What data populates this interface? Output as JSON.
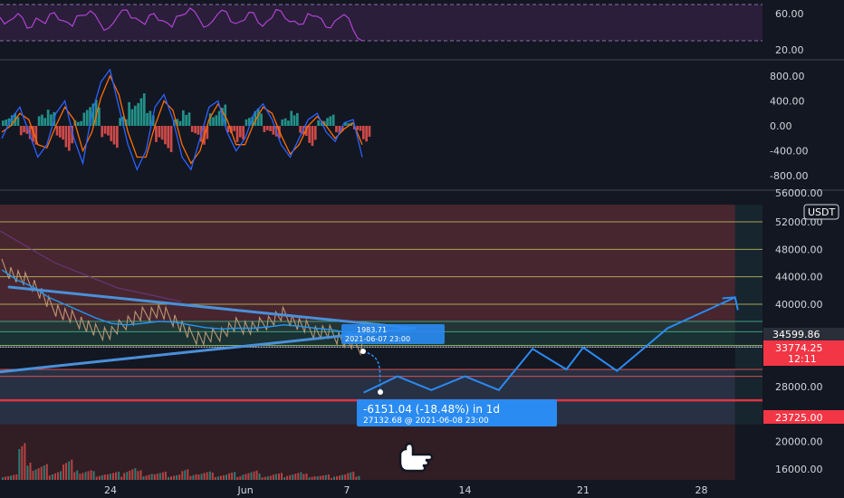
{
  "chart_data": [
    {
      "type": "line",
      "name": "RSI",
      "ylim": [
        10,
        75
      ],
      "yticks": [
        "60.00",
        "20.00"
      ],
      "ytick_values": [
        60,
        20
      ],
      "bands": [
        30,
        70
      ],
      "series": [
        {
          "values": [
            56,
            52,
            60,
            44,
            55,
            49,
            61,
            52,
            46,
            58,
            63,
            50,
            44,
            57,
            64,
            55,
            48,
            60,
            52,
            45,
            58,
            66,
            54,
            47,
            59,
            62,
            49,
            53,
            61,
            46,
            55,
            63,
            51,
            48,
            60,
            57,
            45,
            52,
            59,
            42,
            30
          ]
        }
      ]
    },
    {
      "type": "bar",
      "name": "MACD",
      "ylim": [
        -1000,
        1000
      ],
      "yticks": [
        "800.00",
        "400.00",
        "0.00",
        "-400.00",
        "-800.00"
      ],
      "ytick_values": [
        800,
        400,
        0,
        -400,
        -800
      ],
      "histogram": [
        120,
        200,
        -150,
        -300,
        180,
        260,
        -220,
        -400,
        90,
        300,
        420,
        -180,
        -350,
        150,
        380,
        520,
        240,
        -260,
        -420,
        110,
        250,
        -140,
        -300,
        200,
        340,
        -120,
        -260,
        150,
        280,
        -100,
        -200,
        120,
        240,
        -160,
        -320,
        90,
        180,
        -120,
        60,
        -80,
        -250
      ],
      "macd_line": [
        -200,
        100,
        300,
        -100,
        -500,
        -300,
        200,
        400,
        -200,
        -600,
        200,
        700,
        900,
        300,
        -300,
        -700,
        -400,
        300,
        500,
        100,
        -500,
        -700,
        -200,
        300,
        400,
        -100,
        -400,
        -200,
        200,
        350,
        100,
        -300,
        -500,
        -200,
        100,
        200,
        -100,
        -250,
        50,
        100,
        -500
      ],
      "signal_line": [
        -100,
        0,
        200,
        100,
        -300,
        -350,
        0,
        300,
        100,
        -400,
        -100,
        450,
        800,
        500,
        -100,
        -500,
        -500,
        0,
        400,
        250,
        -300,
        -600,
        -400,
        100,
        350,
        100,
        -300,
        -300,
        50,
        300,
        200,
        -150,
        -450,
        -300,
        0,
        150,
        0,
        -200,
        -50,
        50,
        -300
      ]
    },
    {
      "type": "line",
      "name": "BTC/USDT price",
      "unit": "USDT",
      "ylim": [
        14000,
        58000
      ],
      "yticks": [
        "52000.00",
        "48000.00",
        "44000.00",
        "40000.00",
        "28000.00",
        "20000.00",
        "16000.00"
      ],
      "ytick_values": [
        52000,
        48000,
        44000,
        40000,
        28000,
        20000,
        16000
      ],
      "x": [
        "2021-05-16",
        "2021-05-17",
        "2021-05-18",
        "2021-05-19",
        "2021-05-20",
        "2021-05-21",
        "2021-05-22",
        "2021-05-23",
        "2021-05-24",
        "2021-05-25",
        "2021-05-26",
        "2021-05-27",
        "2021-05-28",
        "2021-05-29",
        "2021-05-30",
        "2021-05-31",
        "2021-06-01",
        "2021-06-02",
        "2021-06-03",
        "2021-06-04",
        "2021-06-05",
        "2021-06-06",
        "2021-06-07",
        "2021-06-08"
      ],
      "xticks": [
        "24",
        "Jun",
        "7",
        "14",
        "21",
        "28"
      ],
      "xtick_dates": [
        "2021-05-24",
        "2021-06-01",
        "2021-06-07",
        "2021-06-14",
        "2021-06-21",
        "2021-06-28"
      ],
      "series": [
        {
          "values": [
            45500,
            44000,
            43000,
            40000,
            38500,
            37500,
            36000,
            35800,
            37500,
            38500,
            39000,
            37800,
            35500,
            35000,
            35800,
            37000,
            36500,
            37500,
            38500,
            37000,
            36000,
            35800,
            34500,
            33774
          ]
        },
        {
          "values": [
            45000,
            43500,
            42500,
            41000,
            40000,
            39000,
            38000,
            37200,
            37000,
            37200,
            37500,
            37400,
            37000,
            36600,
            36400,
            36500,
            36500,
            36700,
            37000,
            36800,
            36500,
            36300,
            35900,
            35400
          ]
        }
      ],
      "projection": {
        "x": [
          "2021-06-08",
          "2021-06-10",
          "2021-06-12",
          "2021-06-14",
          "2021-06-16",
          "2021-06-18",
          "2021-06-20",
          "2021-06-21",
          "2021-06-23",
          "2021-06-26",
          "2021-06-30"
        ],
        "values": [
          27132,
          29500,
          27500,
          29500,
          27500,
          33500,
          30500,
          33700,
          30300,
          36500,
          41000
        ]
      },
      "horizontal_levels": [
        52000,
        48000,
        44000,
        40000,
        37500,
        36000,
        34000,
        33774,
        30500,
        29500,
        26000
      ],
      "support_level": 23725,
      "trendlines": [
        {
          "from": [
            "2021-05-18",
            42500
          ],
          "to": [
            "2021-06-11",
            36500
          ]
        },
        {
          "from": [
            "2021-05-15",
            29500
          ],
          "to": [
            "2021-06-11",
            36500
          ]
        }
      ],
      "box": {
        "from": "2021-05-17",
        "to": "2021-06-30",
        "top": 54500,
        "bottom": 22500
      },
      "volume": [
        8,
        40,
        18,
        14,
        22,
        12,
        10,
        9,
        16,
        11,
        9,
        8,
        12,
        10,
        8,
        9,
        11,
        7,
        8,
        10,
        7,
        6,
        8,
        9
      ],
      "labels": {
        "unit_label": "USDT",
        "last_price": "34599.86",
        "current_price": "33774.25",
        "countdown": "12:11",
        "support_label": "23725.00",
        "top_tick_partial": "56000.00"
      },
      "annotations": {
        "small_top": "1983.71",
        "small_bottom": "2021-06-07  23:00",
        "measure_main": "-6151.04 (-18.48%) in 1d",
        "measure_sub": "27132.68 @ 2021-06-08  23:00"
      }
    }
  ],
  "colors": {
    "background": "#131722",
    "text": "#d1d4dc",
    "rsi": "#b043d1",
    "rsi_band": "#2a1e3a",
    "macd": "#2962ff",
    "signal": "#ff6d00",
    "hist_pos": "#26a69a",
    "hist_neg": "#ef5350",
    "price": "#2196f3",
    "red_zone": "#5a2c34",
    "green_zone": "#1d3a38",
    "support": "#f23645",
    "projection": "#2a8bf2"
  },
  "icons": {
    "cursor": "hand-pointer-icon"
  }
}
